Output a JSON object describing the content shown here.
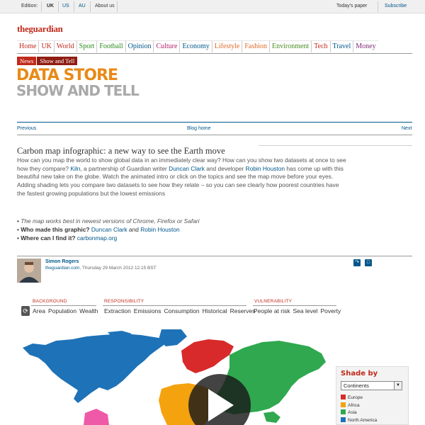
{
  "topbar": {
    "edition_label": "Edition:",
    "editions": [
      "UK",
      "US",
      "AU"
    ],
    "about": "About us",
    "todays_paper": "Today's paper",
    "subscribe": "Subscribe"
  },
  "logo": "theguardian",
  "nav": {
    "items": [
      {
        "label": "Home",
        "color": "#c12a1b"
      },
      {
        "label": "UK",
        "color": "#c12a1b"
      },
      {
        "label": "World",
        "color": "#c12a1b"
      },
      {
        "label": "Sport",
        "color": "#2b8a1e"
      },
      {
        "label": "Football",
        "color": "#2b8a1e"
      },
      {
        "label": "Opinion",
        "color": "#005689"
      },
      {
        "label": "Culture",
        "color": "#b5216b"
      },
      {
        "label": "Economy",
        "color": "#005689"
      },
      {
        "label": "Lifestyle",
        "color": "#e26a28"
      },
      {
        "label": "Fashion",
        "color": "#e26a28"
      },
      {
        "label": "Environment",
        "color": "#4a8d21"
      },
      {
        "label": "Tech",
        "color": "#c12a1b"
      },
      {
        "label": "Travel",
        "color": "#005689"
      },
      {
        "label": "Money",
        "color": "#7d2a7a"
      }
    ]
  },
  "breadcrumb": [
    "News",
    "Show and Tell"
  ],
  "section": {
    "title1": "DATA STORE",
    "title2": "SHOW AND TELL"
  },
  "pager": {
    "previous": "Previous",
    "blog_home": "Blog home",
    "next": "Next"
  },
  "article": {
    "headline": "Carbon map infographic: a new way to see the Earth move",
    "p1a": "How can you map the world to show global data in an immediately clear way? How can you show two datasets at once to see how they compare? ",
    "kiln": "Kiln",
    "p1b": ", a partnership of Guardian writer ",
    "duncan": "Duncan Clark",
    "p1c": " and developer ",
    "robin": "Robin Houston",
    "p1d": " has come up with this beautiful new take on the globe. Watch the animated intro or click on the topics and see the map move before your eyes. Adding shading lets you compare two datasets to see how they relate – so you can see clearly how poorest countries have the fastest growing populations but the lowest emissions",
    "bullet1": "The map works best in newest versions of Chrome, Firefox or Safari",
    "bullet2_q": "Who made this graphic?",
    "bullet2_a1": "Duncan Clark",
    "bullet2_and": "and",
    "bullet2_a2": "Robin Houston",
    "bullet3_q": "Where can I find it?",
    "bullet3_link": "carbonmap.org"
  },
  "author": {
    "name": "Simon Rogers",
    "source": "theguardian.com",
    "date": ", Thursday 29 March 2012 12.15 BST"
  },
  "map_controls": {
    "background": {
      "heading": "BACKGROUND",
      "items": [
        "Area",
        "Population",
        "Wealth"
      ]
    },
    "responsibility": {
      "heading": "RESPONSIBILITY",
      "items": [
        "Extraction",
        "Emissions",
        "Consumption",
        "Historical",
        "Reserves"
      ]
    },
    "vulnerability": {
      "heading": "VULNERABILITY",
      "items": [
        "People at risk",
        "Sea level",
        "Poverty"
      ]
    }
  },
  "shade_panel": {
    "title": "Shade by",
    "selected": "Continents",
    "legend": [
      {
        "label": "Europe",
        "color": "#d82a2a"
      },
      {
        "label": "Africa",
        "color": "#f5a20f"
      },
      {
        "label": "Asia",
        "color": "#2fa84f"
      },
      {
        "label": "North America",
        "color": "#1e72b8"
      }
    ]
  },
  "colors": {
    "guardian_red": "#c12a1b",
    "link_blue": "#005689",
    "data_store_orange": "#e98a17"
  }
}
